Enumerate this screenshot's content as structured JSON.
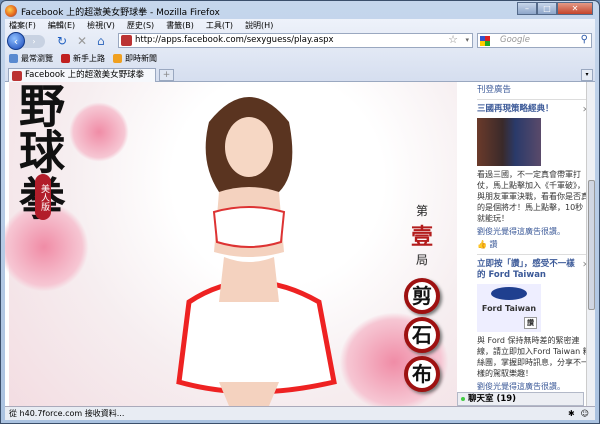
{
  "window": {
    "title": "Facebook 上的超激美女野球拳 - Mozilla Firefox",
    "minimize": "–",
    "maximize": "□",
    "close": "✕"
  },
  "menu": [
    "檔案(F)",
    "編輯(E)",
    "檢視(V)",
    "歷史(S)",
    "書籤(B)",
    "工具(T)",
    "說明(H)"
  ],
  "nav": {
    "url": "http://apps.facebook.com/sexyguess/play.aspx",
    "search_placeholder": "Google",
    "back": "‹",
    "forward": "›",
    "reload": "↻",
    "stop": "✕",
    "home": "⌂"
  },
  "bookmarks": [
    {
      "label": "最常瀏覽",
      "color": "#5a8ad0"
    },
    {
      "label": "新手上路",
      "color": "#c02020"
    },
    {
      "label": "即時新聞",
      "color": "#f0a020"
    }
  ],
  "tabs": [
    {
      "label": "Facebook 上的超激美女野球拳"
    }
  ],
  "game": {
    "title": "野球拳",
    "badge": "美人版",
    "round_prefix": "第",
    "round_num": "壹",
    "round_suffix": "局",
    "rps": [
      "剪",
      "石",
      "布"
    ]
  },
  "ads": {
    "header": "刊登廣告",
    "items": [
      {
        "title": "三國再現策略經典！",
        "body": "看過三國，不一定真會帶軍打仗，馬上點擊加入《千軍破》，與朋友軍軍決戰，看看你是否真的是個將才！馬上點擊，10秒就能玩！",
        "liker": "劉俊光覺得這廣告很讚。",
        "like": "讚"
      },
      {
        "title": "立即按「讚」，感受不一樣的 Ford Taiwan",
        "image_text": "Ford Taiwan",
        "image_like": "讚",
        "body": "與 Ford 保持無時差的緊密連線，請立即加入Ford Taiwan 粉絲團，掌握即時訊息，分享不一樣的駕馭樂趣！",
        "liker": "劉俊光覺得這廣告很讚。"
      }
    ]
  },
  "chat": {
    "label": "聊天室 (19)"
  },
  "status": {
    "text": "從 h40.7force.com 接收資料..."
  }
}
